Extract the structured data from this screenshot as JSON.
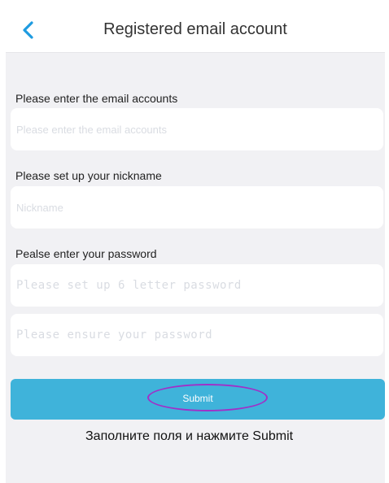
{
  "header": {
    "back_icon": "chevron-left-icon",
    "title": "Registered email account"
  },
  "form": {
    "email": {
      "label": "Please enter the email accounts",
      "placeholder": "Please enter the email accounts"
    },
    "nickname": {
      "label": "Please set up your nickname",
      "placeholder": "Nickname"
    },
    "password": {
      "label": "Pealse enter your password",
      "placeholder": "Please set up 6 letter password",
      "confirm_placeholder": "Please ensure your password"
    }
  },
  "submit": {
    "label": "Submit"
  },
  "annotation": {
    "instruction": "Заполните поля и нажмите Submit",
    "highlight_color": "#a030c8"
  },
  "colors": {
    "accent": "#3fb3da",
    "background": "#f1f1f4",
    "back_icon": "#1e9be0"
  }
}
